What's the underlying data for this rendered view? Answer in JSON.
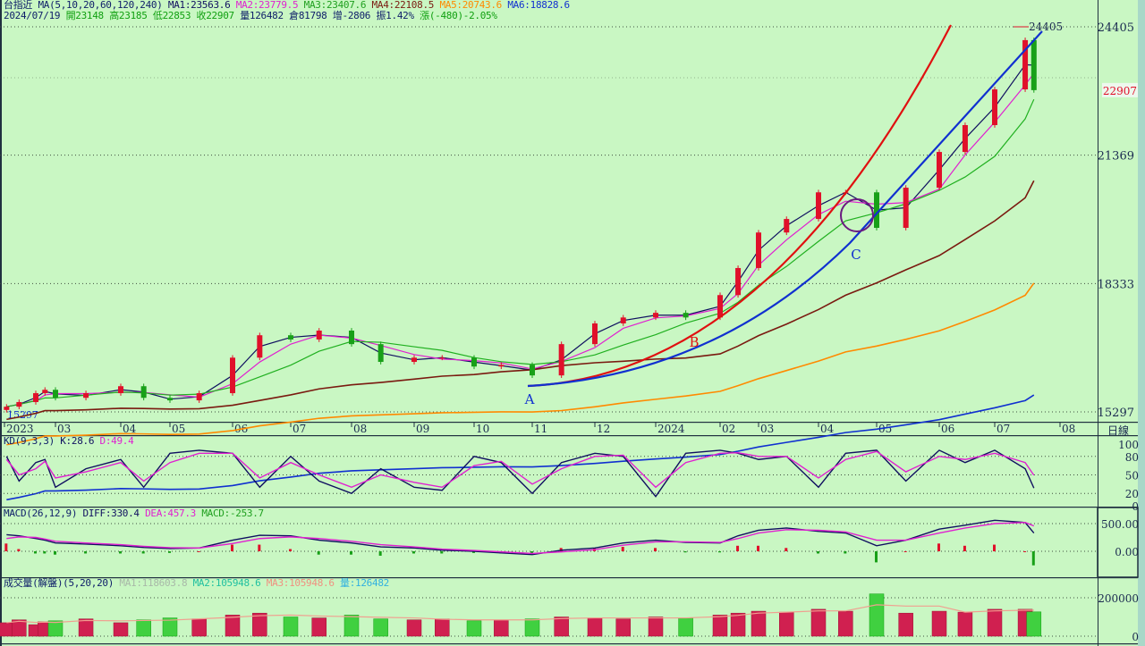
{
  "header": {
    "line1": {
      "name": "台指近",
      "ma_spec": "MA(5,10,20,60,120,240)",
      "ma1": "MA1:23563.6",
      "ma2": "MA2:23779.5",
      "ma3": "MA3:23407.6",
      "ma4": "MA4:22108.5",
      "ma5": "MA5:20743.6",
      "ma6": "MA6:18828.6"
    },
    "line2": {
      "date": "2024/07/19",
      "open": "開23148",
      "high": "高23185",
      "low": "低22853",
      "close": "收22907",
      "volume": "量126482",
      "oi": "倉81798",
      "oi_change": "增-2806",
      "amplitude": "振1.42%",
      "change": "漲(-480)-2.05%"
    }
  },
  "kd_header": {
    "spec": "KD(9,3,3)",
    "k": "K:28.6",
    "d": "D:49.4"
  },
  "macd_header": {
    "spec": "MACD(26,12,9)",
    "diff": "DIFF:330.4",
    "dea": "DEA:457.3",
    "macd": "MACD:-253.7"
  },
  "vol_header": {
    "spec": "成交量(解盤)(5,20,20)",
    "ma1": "MA1:118603.8",
    "ma2": "MA2:105948.6",
    "ma3": "MA3:105948.6",
    "vol": "量:126482"
  },
  "period_label": "日線",
  "colors": {
    "background": "#c9f7c3",
    "up": "#e0102a",
    "down": "#18a018",
    "ma1": "#101060",
    "ma2": "#e020d0",
    "ma3": "#20b020",
    "ma4": "#7a1a10",
    "ma5": "#ff8a00",
    "ma6": "#1030d0",
    "trend_red": "#e01010",
    "trend_blue": "#1030d0"
  },
  "chart_data": [
    {
      "type": "candlestick",
      "title": "台指近",
      "x_ticks": [
        "2023",
        "03",
        "04",
        "05",
        "06",
        "07",
        "08",
        "09",
        "10",
        "11",
        "12",
        "2024",
        "02",
        "03",
        "04",
        "05",
        "06",
        "07",
        "08"
      ],
      "y_ticks": [
        24405,
        21369,
        18333,
        15297
      ],
      "ylim": [
        15297,
        24405
      ],
      "last_price": 22907,
      "high_marker": 24405,
      "low_marker": 15297,
      "dates": [
        "2023-01-03",
        "2023-01-15",
        "2023-02-01",
        "2023-02-15",
        "2023-03-01",
        "2023-03-15",
        "2023-04-01",
        "2023-04-15",
        "2023-05-01",
        "2023-05-15",
        "2023-06-01",
        "2023-06-15",
        "2023-07-01",
        "2023-07-15",
        "2023-08-01",
        "2023-08-15",
        "2023-09-01",
        "2023-09-15",
        "2023-10-01",
        "2023-10-15",
        "2023-11-01",
        "2023-11-15",
        "2023-12-01",
        "2023-12-15",
        "2024-01-01",
        "2024-01-15",
        "2024-02-01",
        "2024-02-15",
        "2024-03-01",
        "2024-03-15",
        "2024-04-01",
        "2024-04-15",
        "2024-05-01",
        "2024-05-15",
        "2024-06-01",
        "2024-06-15",
        "2024-07-01",
        "2024-07-15",
        "2024-07-19"
      ],
      "close": [
        15420,
        15530,
        15740,
        15820,
        15630,
        15740,
        15905,
        15630,
        15570,
        15740,
        16580,
        17110,
        17010,
        17220,
        16900,
        16480,
        16580,
        16580,
        16370,
        16410,
        16160,
        16900,
        17390,
        17530,
        17640,
        17530,
        18060,
        18700,
        19540,
        19860,
        20490,
        20490,
        19650,
        20600,
        21445,
        22080,
        22925,
        24090,
        22907
      ],
      "annotations": [
        {
          "text": "A",
          "date": "2023-11-01"
        },
        {
          "text": "B",
          "date": "2024-02-01"
        },
        {
          "text": "C",
          "date": "2024-04-20"
        }
      ]
    },
    {
      "type": "line",
      "title": "KD(9,3,3)",
      "y_ticks": [
        100,
        80,
        50,
        20,
        0
      ],
      "ylim": [
        0,
        100
      ],
      "series": [
        {
          "name": "K",
          "values": [
            80,
            40,
            70,
            75,
            30,
            60,
            75,
            30,
            85,
            90,
            85,
            30,
            80,
            40,
            20,
            60,
            30,
            25,
            80,
            70,
            20,
            70,
            85,
            80,
            15,
            85,
            90,
            85,
            75,
            80,
            30,
            85,
            90,
            40,
            90,
            70,
            90,
            60,
            28.6
          ]
        },
        {
          "name": "D",
          "values": [
            75,
            50,
            60,
            72,
            45,
            55,
            70,
            40,
            70,
            85,
            85,
            45,
            70,
            50,
            30,
            50,
            38,
            30,
            65,
            72,
            35,
            60,
            80,
            82,
            30,
            70,
            85,
            86,
            80,
            80,
            45,
            75,
            88,
            55,
            80,
            75,
            85,
            70,
            49.4
          ]
        }
      ]
    },
    {
      "type": "line+bar",
      "title": "MACD(26,12,9)",
      "y_ticks": [
        500,
        0
      ],
      "ylim": [
        -350,
        750
      ],
      "series": [
        {
          "name": "DIFF",
          "values": [
            300,
            280,
            230,
            200,
            150,
            130,
            100,
            70,
            50,
            60,
            200,
            290,
            280,
            200,
            150,
            80,
            60,
            20,
            0,
            -30,
            -60,
            20,
            60,
            150,
            200,
            160,
            150,
            280,
            380,
            420,
            360,
            330,
            100,
            200,
            400,
            470,
            560,
            520,
            330.4
          ]
        },
        {
          "name": "DEA",
          "values": [
            230,
            260,
            250,
            220,
            180,
            150,
            120,
            90,
            65,
            60,
            140,
            230,
            260,
            230,
            180,
            120,
            80,
            40,
            15,
            -10,
            -40,
            -10,
            30,
            110,
            170,
            170,
            160,
            230,
            330,
            390,
            380,
            350,
            200,
            200,
            330,
            420,
            500,
            520,
            457.3
          ]
        },
        {
          "name": "MACD",
          "values": [
            140,
            40,
            -40,
            -40,
            -60,
            -40,
            -40,
            -40,
            -30,
            0,
            120,
            120,
            40,
            -60,
            -60,
            -80,
            -40,
            -40,
            -30,
            -40,
            -40,
            60,
            60,
            80,
            60,
            -20,
            -20,
            100,
            100,
            60,
            -40,
            -40,
            -200,
            0,
            140,
            100,
            120,
            0,
            -253.7
          ]
        }
      ]
    },
    {
      "type": "bar",
      "title": "成交量(解盤)(5,20,20)",
      "y_ticks": [
        200000,
        0
      ],
      "ylim": [
        0,
        240000
      ],
      "values": [
        70000,
        85000,
        60000,
        75000,
        80000,
        90000,
        70000,
        85000,
        95000,
        90000,
        110000,
        120000,
        100000,
        95000,
        110000,
        90000,
        85000,
        90000,
        80000,
        85000,
        90000,
        100000,
        95000,
        90000,
        100000,
        95000,
        110000,
        120000,
        130000,
        125000,
        140000,
        130000,
        220000,
        120000,
        130000,
        125000,
        140000,
        140000,
        126482
      ]
    }
  ]
}
